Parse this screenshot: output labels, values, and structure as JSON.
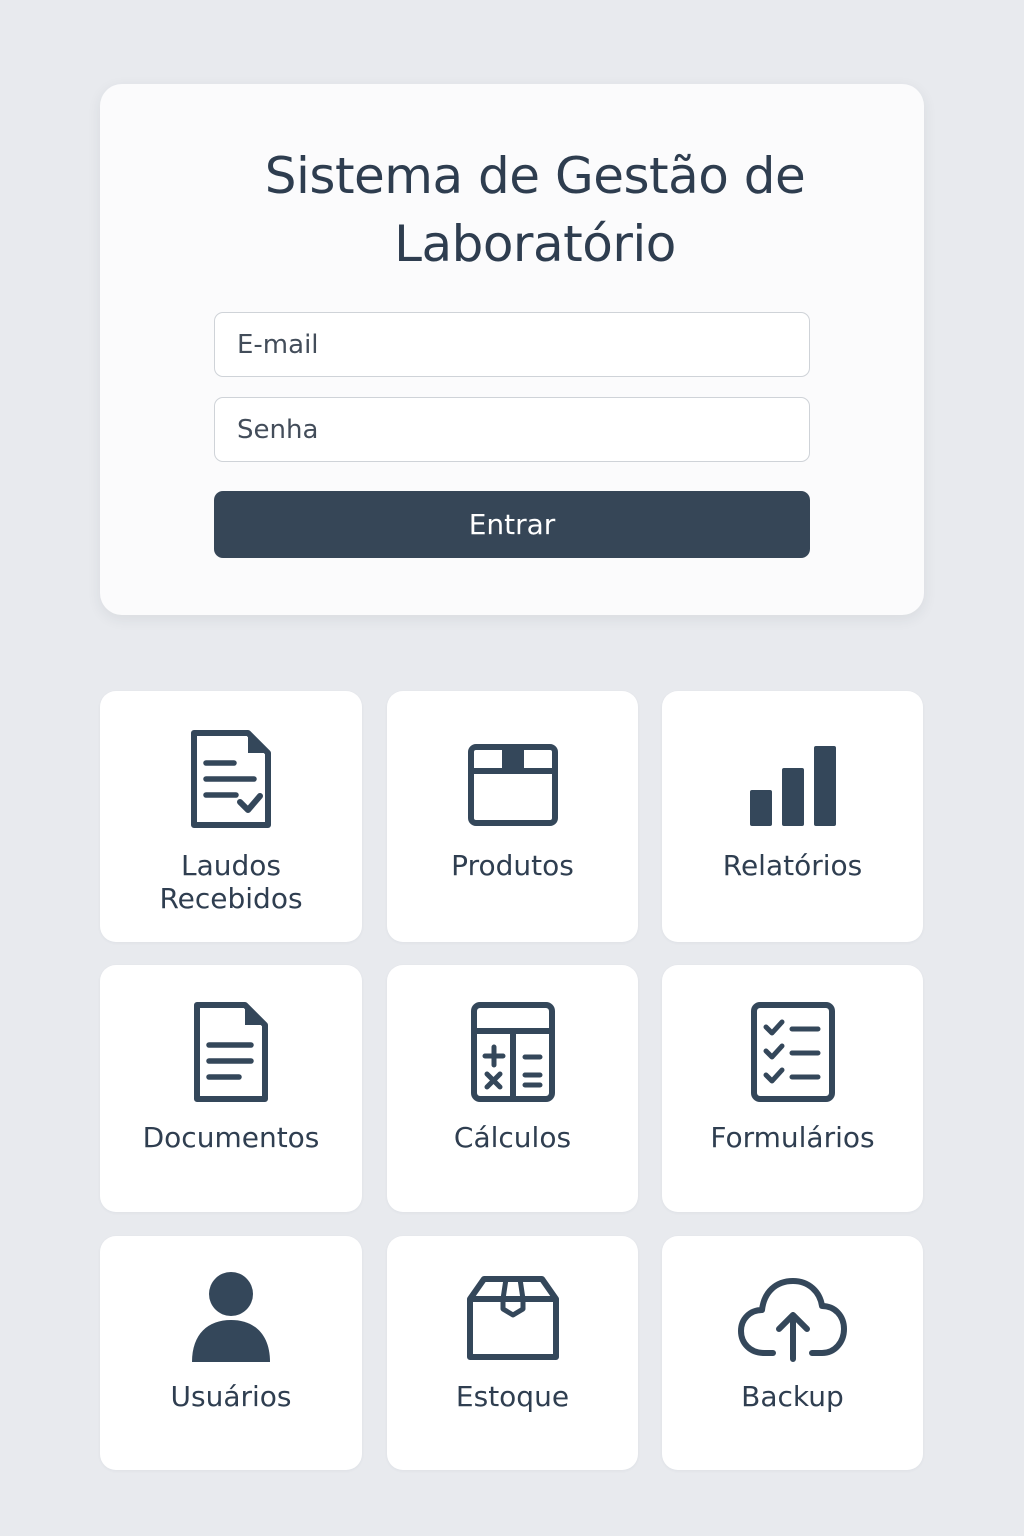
{
  "login": {
    "title_line1": "Sistema de Gestão de",
    "title_line2": "Laboratório",
    "email_placeholder": "E-mail",
    "password_placeholder": "Senha",
    "submit_label": "Entrar"
  },
  "menu": {
    "items": [
      {
        "label_line1": "Laudos",
        "label_line2": "Recebidos",
        "icon": "report-check-icon"
      },
      {
        "label": "Produtos",
        "icon": "box-icon"
      },
      {
        "label": "Relatórios",
        "icon": "bar-chart-icon"
      },
      {
        "label": "Documentos",
        "icon": "document-icon"
      },
      {
        "label": "Cálculos",
        "icon": "calculator-icon"
      },
      {
        "label": "Formulários",
        "icon": "checklist-icon"
      },
      {
        "label": "Usuários",
        "icon": "user-icon"
      },
      {
        "label": "Estoque",
        "icon": "package-icon"
      },
      {
        "label": "Backup",
        "icon": "cloud-upload-icon"
      }
    ]
  },
  "colors": {
    "background": "#e8eaee",
    "card": "#fbfbfc",
    "text": "#2f3e50",
    "button": "#364657",
    "icon": "#34475a"
  }
}
